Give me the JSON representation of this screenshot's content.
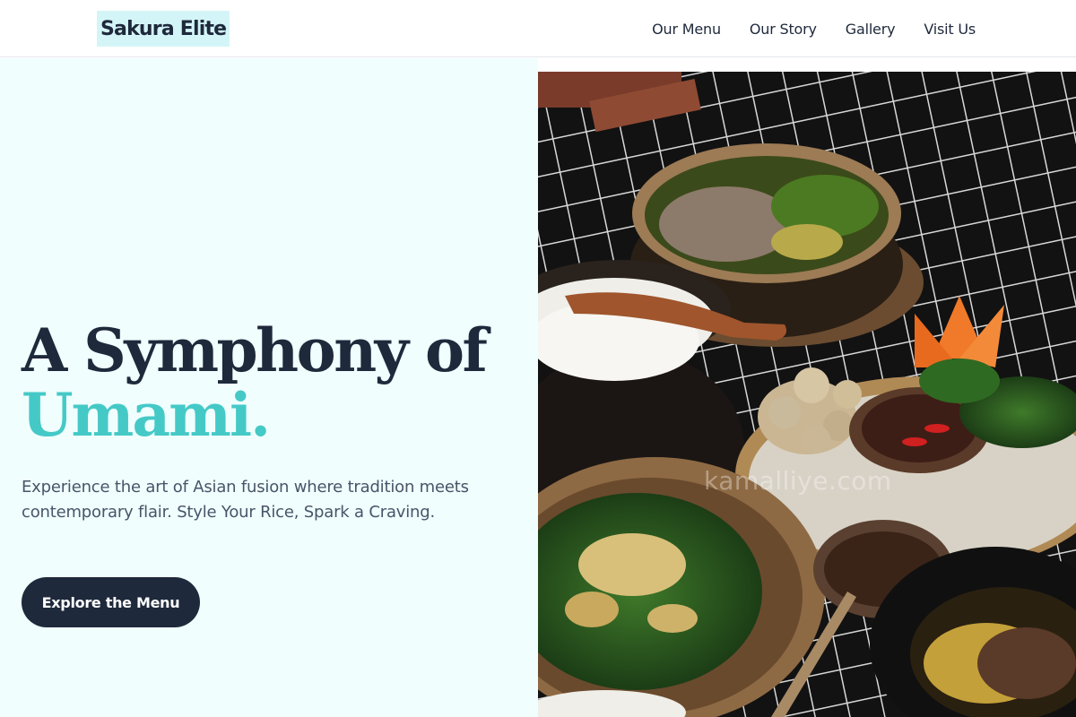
{
  "brand": {
    "name": "Sakura Elite"
  },
  "nav": {
    "items": [
      {
        "label": "Our Menu"
      },
      {
        "label": "Our Story"
      },
      {
        "label": "Gallery"
      },
      {
        "label": "Visit Us"
      }
    ]
  },
  "hero": {
    "headline_line1": "A Symphony of",
    "headline_line2": "Umami.",
    "subtext": "Experience the art of Asian fusion where tradition meets contemporary flair. Style Your Rice, Spark a Craving.",
    "cta_label": "Explore the Menu"
  },
  "image": {
    "watermark": "kamalliye.com"
  },
  "colors": {
    "accent": "#45c9c7",
    "dark": "#1e293b",
    "hero_bg": "#f0fefe",
    "logo_bg": "#d4f5f7"
  }
}
